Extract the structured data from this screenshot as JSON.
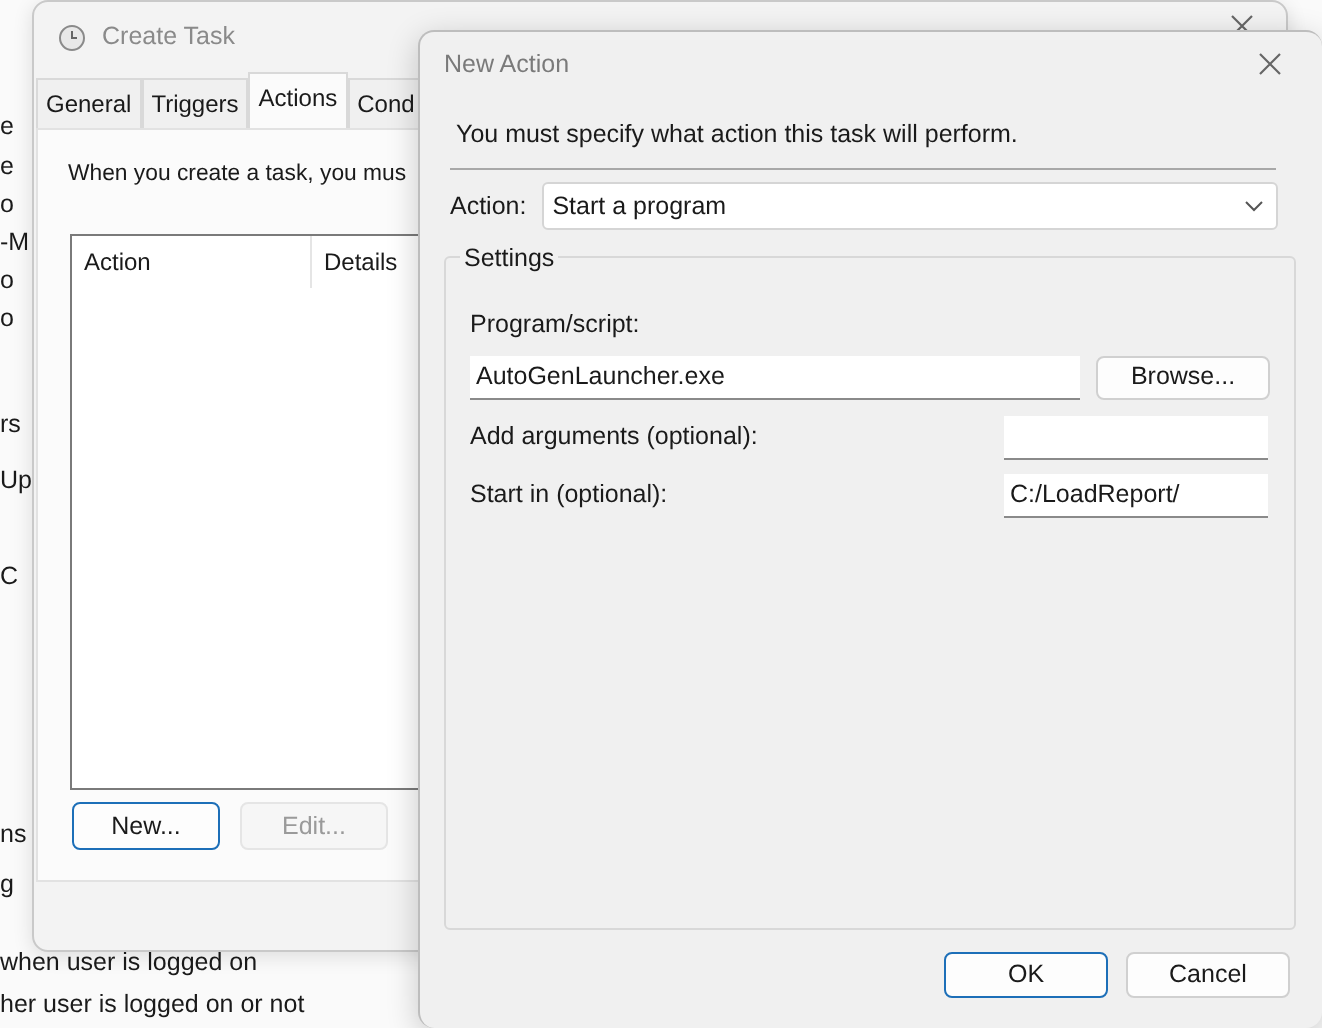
{
  "background_window": {
    "fragments": [
      "e",
      "e",
      "o",
      "-M",
      "o",
      "o",
      "rs",
      "Up",
      "C",
      "ns",
      "g"
    ],
    "lines": [
      "when user is logged on",
      "her user is logged on or not"
    ]
  },
  "create_task": {
    "title": "Create Task",
    "active": false,
    "tabs": [
      {
        "label": "General",
        "selected": false
      },
      {
        "label": "Triggers",
        "selected": false
      },
      {
        "label": "Actions",
        "selected": true
      },
      {
        "label": "Cond",
        "selected": false
      }
    ],
    "description": "When you create a task, you mus",
    "table": {
      "columns": [
        "Action",
        "Details"
      ]
    },
    "buttons": [
      {
        "label": "New...",
        "disabled": false,
        "default": true
      },
      {
        "label": "Edit...",
        "disabled": true,
        "default": false
      }
    ]
  },
  "new_action": {
    "title": "New Action",
    "active": true,
    "instruction": "You must specify what action this task will perform.",
    "action": {
      "label": "Action:",
      "value": "Start a program"
    },
    "settings": {
      "legend": "Settings",
      "fields": [
        {
          "kind": "browse",
          "label": "Program/script:",
          "value": "AutoGenLauncher.exe",
          "button": "Browse..."
        },
        {
          "kind": "inline",
          "label": "Add arguments (optional):"
        },
        {
          "kind": "inline",
          "label": "Start in (optional):",
          "value": "C:/LoadReport/"
        }
      ]
    },
    "buttons": [
      {
        "label": "OK",
        "default": true
      },
      {
        "label": "Cancel",
        "default": false
      }
    ]
  }
}
